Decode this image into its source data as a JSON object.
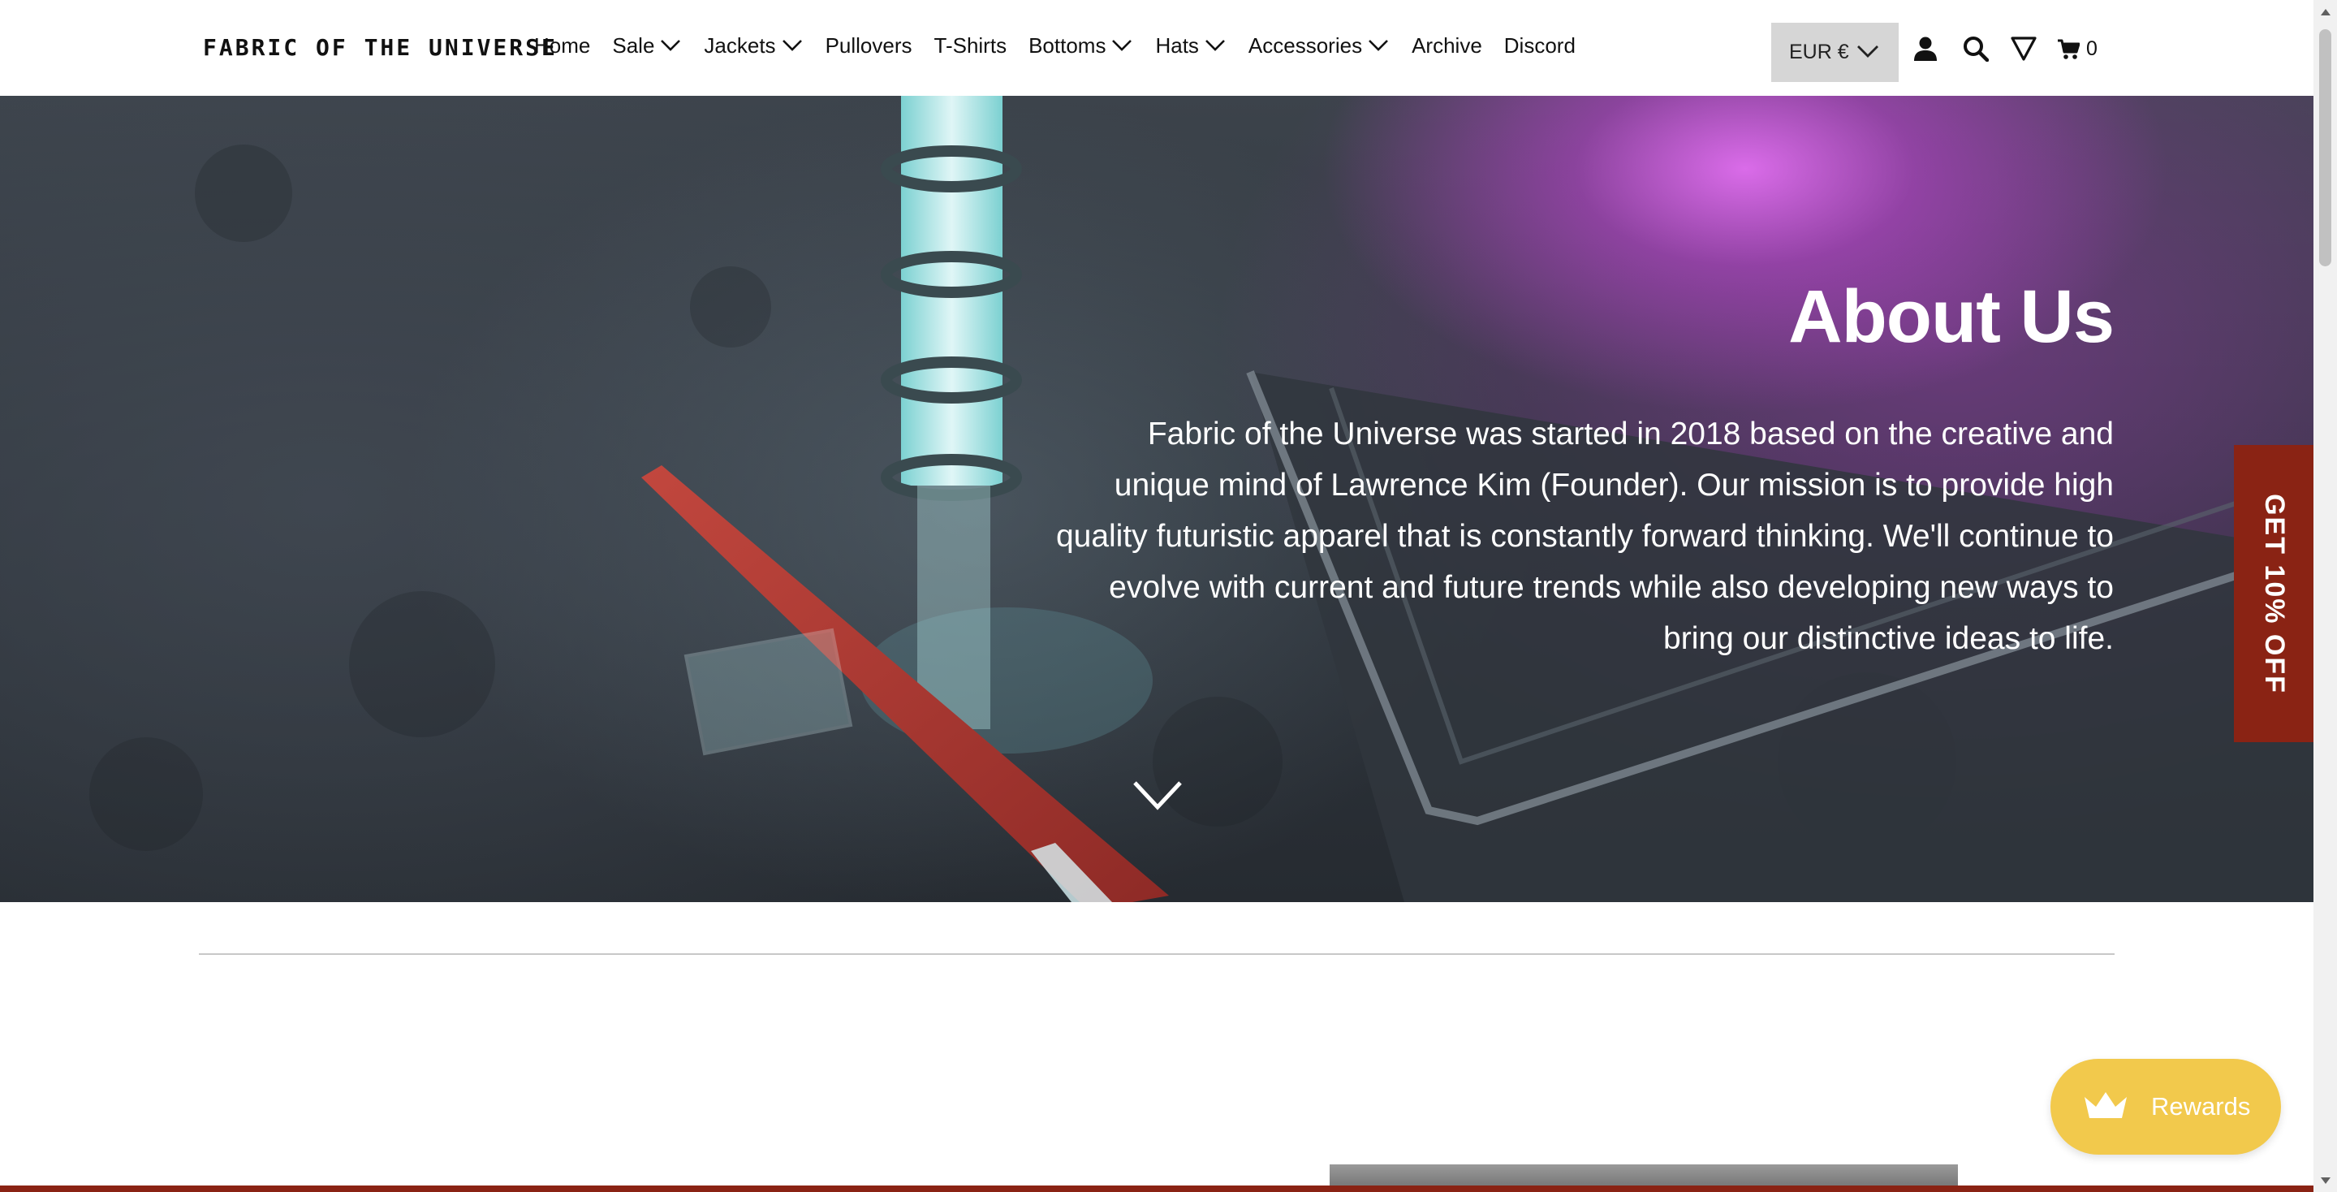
{
  "header": {
    "logo": "FABRIC OF THE UNIVERSE",
    "nav": [
      {
        "label": "Home",
        "dropdown": false
      },
      {
        "label": "Sale",
        "dropdown": true
      },
      {
        "label": "Jackets",
        "dropdown": true
      },
      {
        "label": "Pullovers",
        "dropdown": false
      },
      {
        "label": "T-Shirts",
        "dropdown": false
      },
      {
        "label": "Bottoms",
        "dropdown": true
      },
      {
        "label": "Hats",
        "dropdown": true
      },
      {
        "label": "Accessories",
        "dropdown": true
      },
      {
        "label": "Archive",
        "dropdown": false
      },
      {
        "label": "Discord",
        "dropdown": false
      }
    ],
    "currency": "EUR €",
    "icons": [
      "account-icon",
      "search-icon",
      "filter-icon",
      "cart-icon"
    ],
    "cart_count": "0"
  },
  "hero": {
    "title": "About Us",
    "body": "Fabric of the Universe was started in 2018 based on the creative and unique mind of Lawrence Kim (Founder).  Our mission is to provide high quality futuristic apparel that is constantly forward thinking.  We'll continue to evolve with current and future trends while also developing new ways to bring our distinctive ideas to life.",
    "scroll_icon": "chevron-down-icon"
  },
  "side_tab": {
    "label": "GET 10% OFF"
  },
  "rewards": {
    "label": "Rewards",
    "icon": "crown-icon"
  },
  "colors": {
    "accent": "#8a2314",
    "rewards": "#f2c94c",
    "currency_bg": "#d6d6d6"
  }
}
